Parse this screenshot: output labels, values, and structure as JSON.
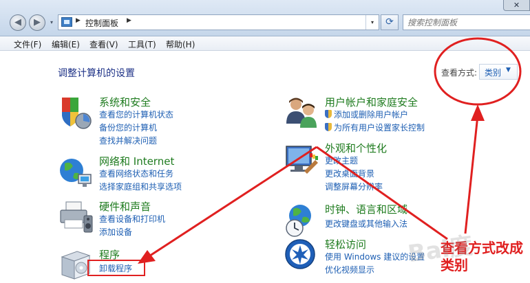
{
  "window": {
    "close_glyph": "✕"
  },
  "nav": {
    "back_glyph": "◀",
    "forward_glyph": "▶",
    "history_glyph": "▾",
    "address": {
      "sep": "▶",
      "crumb": "控制面板",
      "dropdown_glyph": "▾"
    },
    "refresh_glyph": "⟳",
    "search_placeholder": "搜索控制面板"
  },
  "menu": [
    "文件(F)",
    "编辑(E)",
    "查看(V)",
    "工具(T)",
    "帮助(H)"
  ],
  "page_title": "调整计算机的设置",
  "view_by": {
    "label": "查看方式:",
    "value": "类别",
    "caret": "▼"
  },
  "categories": [
    {
      "heading": "系统和安全",
      "links": [
        "查看您的计算机状态",
        "备份您的计算机",
        "查找并解决问题"
      ]
    },
    {
      "heading": "网络和 Internet",
      "links": [
        "查看网络状态和任务",
        "选择家庭组和共享选项"
      ]
    },
    {
      "heading": "硬件和声音",
      "links": [
        "查看设备和打印机",
        "添加设备"
      ]
    },
    {
      "heading": "程序",
      "links": [
        "卸载程序"
      ]
    },
    {
      "heading": "用户帐户和家庭安全",
      "links": [
        "添加或删除用户帐户",
        "为所有用户设置家长控制"
      ]
    },
    {
      "heading": "外观和个性化",
      "links": [
        "更改主题",
        "更改桌面背景",
        "调整屏幕分辨率"
      ]
    },
    {
      "heading": "时钟、语言和区域",
      "links": [
        "更改键盘或其他输入法"
      ]
    },
    {
      "heading": "轻松访问",
      "links": [
        "使用 Windows 建议的设置",
        "优化视频显示"
      ]
    }
  ],
  "annotation": {
    "line1": "查看方式改成",
    "line2": "类别"
  },
  "watermark": "Bai度",
  "colors": {
    "heading_green": "#1e7b1e",
    "link_blue": "#1e5fb3",
    "title_blue": "#1e3287",
    "annotation_red": "#e02020"
  }
}
